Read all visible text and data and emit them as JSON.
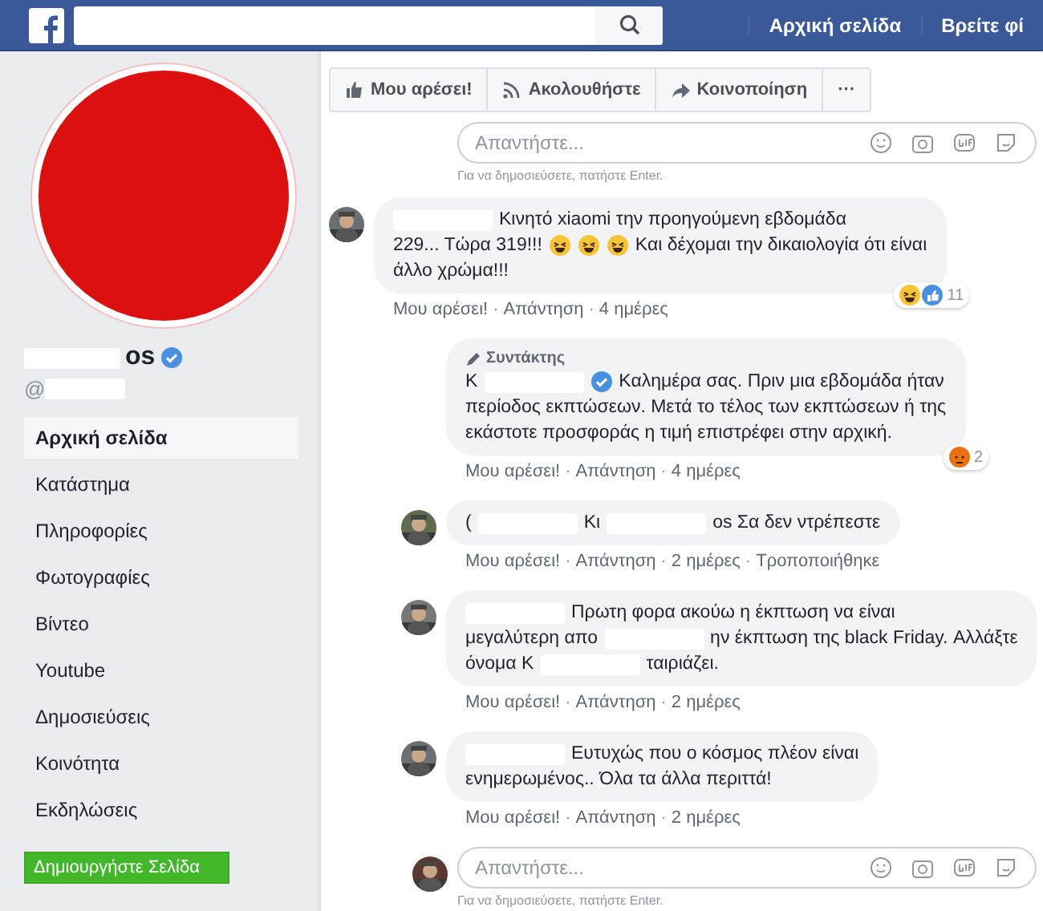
{
  "topbar": {
    "nav": [
      {
        "label": "Αρχική σελίδα"
      },
      {
        "label": "Βρείτε φί"
      }
    ]
  },
  "page": {
    "name": "os",
    "handle": "@",
    "verified": true
  },
  "sidebar": {
    "items": [
      {
        "label": "Αρχική σελίδα",
        "selected": true
      },
      {
        "label": "Κατάστημα",
        "selected": false
      },
      {
        "label": "Πληροφορίες",
        "selected": false
      },
      {
        "label": "Φωτογραφίες",
        "selected": false
      },
      {
        "label": "Βίντεο",
        "selected": false
      },
      {
        "label": "Youtube",
        "selected": false
      },
      {
        "label": "Δημοσιεύσεις",
        "selected": false
      },
      {
        "label": "Κοινότητα",
        "selected": false
      },
      {
        "label": "Εκδηλώσεις",
        "selected": false
      }
    ],
    "create_button": "Δημιουργήστε Σελίδα"
  },
  "actions": [
    {
      "kind": "like",
      "label": "Μου αρέσει!"
    },
    {
      "kind": "follow",
      "label": "Ακολουθήστε"
    },
    {
      "kind": "share",
      "label": "Κοινοποίηση"
    },
    {
      "kind": "more",
      "label": "···"
    }
  ],
  "separator": "·",
  "reply_box_top": {
    "placeholder": "Απαντήστε...",
    "hint": "Για να δημοσιεύσετε, πατήστε Enter."
  },
  "comments": [
    {
      "lines": [
        [
          {
            "kind": "redacted"
          },
          {
            "kind": "text",
            "text": "Κινητό xiaomi την προηγούμενη εβδομάδα"
          }
        ],
        [
          {
            "kind": "text",
            "text": "229... Τώρα 319!!!"
          },
          {
            "kind": "emoji"
          },
          {
            "kind": "emoji"
          },
          {
            "kind": "emoji"
          },
          {
            "kind": "text",
            "text": "Και δέχομαι την δικαιολογία ότι είναι"
          }
        ],
        [
          {
            "kind": "text",
            "text": "άλλο χρώμα!!!"
          }
        ]
      ],
      "meta": [
        "Μου αρέσει!",
        "Απάντηση",
        "4 ημέρες"
      ],
      "reactions": {
        "icons": [
          {
            "kind": "haha"
          },
          {
            "kind": "like"
          }
        ],
        "count": "11"
      },
      "children": [
        {
          "badge": "Συντάκτης",
          "lines": [
            [
              {
                "kind": "text",
                "text": "Κ"
              },
              {
                "kind": "redacted"
              },
              {
                "kind": "verified"
              },
              {
                "kind": "text",
                "text": "Καλημέρα σας. Πριν μια εβδομάδα ήταν"
              }
            ],
            [
              {
                "kind": "text",
                "text": "περίοδος εκπτώσεων. Μετά το τέλος των εκπτώσεων ή της"
              }
            ],
            [
              {
                "kind": "text",
                "text": "εκάστοτε προσφοράς η τιμή επιστρέφει στην αρχική."
              }
            ]
          ],
          "meta": [
            "Μου αρέσει!",
            "Απάντηση",
            "4 ημέρες"
          ],
          "reactions": {
            "icons": [
              {
                "kind": "angry"
              }
            ],
            "count": "2"
          }
        },
        {
          "lines": [
            [
              {
                "kind": "text",
                "text": "("
              },
              {
                "kind": "redacted"
              },
              {
                "kind": "text",
                "text": "Κι"
              },
              {
                "kind": "redacted"
              },
              {
                "kind": "text",
                "text": "os Σα δεν ντρέπεστε"
              }
            ]
          ],
          "meta": [
            "Μου αρέσει!",
            "Απάντηση",
            "2 ημέρες",
            "Τροποποιήθηκε"
          ]
        },
        {
          "lines": [
            [
              {
                "kind": "redacted"
              },
              {
                "kind": "text",
                "text": "Πρωτη φορα ακούω η έκπτωση να είναι"
              }
            ],
            [
              {
                "kind": "text",
                "text": "μεγαλύτερη απο"
              },
              {
                "kind": "redacted"
              },
              {
                "kind": "text",
                "text": "ην έκπτωση της black Friday. Αλλάξτε"
              }
            ],
            [
              {
                "kind": "text",
                "text": "όνομα Κ"
              },
              {
                "kind": "redacted"
              },
              {
                "kind": "text",
                "text": "ταιριάζει."
              }
            ]
          ],
          "meta": [
            "Μου αρέσει!",
            "Απάντηση",
            "2 ημέρες"
          ]
        },
        {
          "lines": [
            [
              {
                "kind": "redacted"
              },
              {
                "kind": "text",
                "text": "Ευτυχώς που ο κόσμος πλέον είναι"
              }
            ],
            [
              {
                "kind": "text",
                "text": "ενημερωμένος.. Όλα τα άλλα περιττά!"
              }
            ]
          ],
          "meta": [
            "Μου αρέσει!",
            "Απάντηση",
            "2 ημέρες"
          ]
        }
      ]
    }
  ],
  "reply_box_bottom": {
    "placeholder": "Απαντήστε...",
    "hint": "Για να δημοσιεύσετε, πατήστε Enter."
  }
}
